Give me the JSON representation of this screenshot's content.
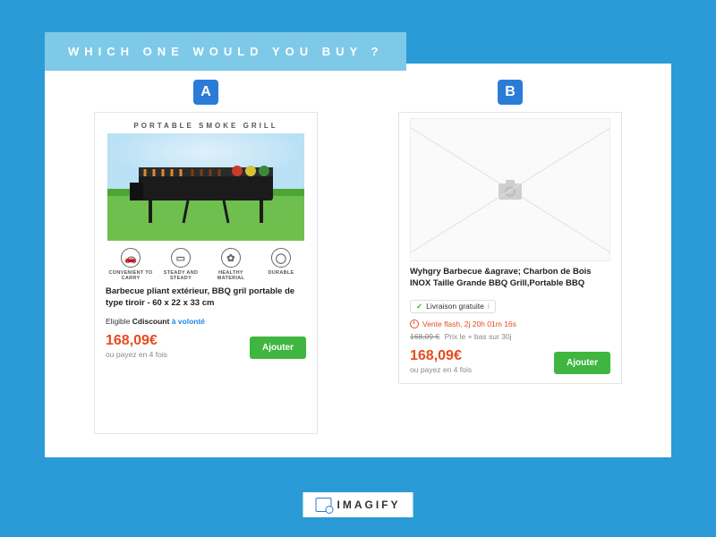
{
  "banner": "WHICH ONE WOULD YOU BUY ?",
  "badges": {
    "a": "A",
    "b": "B"
  },
  "productA": {
    "img_banner": "PORTABLE SMOKE GRILL",
    "features": [
      {
        "icon": "🚗",
        "label": "CONVENIENT TO CARRY"
      },
      {
        "icon": "▭",
        "label": "STEADY AND STEADY"
      },
      {
        "icon": "✿",
        "label": "HEALTHY MATERIAL"
      },
      {
        "icon": "◯",
        "label": "DURABLE"
      }
    ],
    "title": "Barbecue pliant extérieur, BBQ gril portable de type tiroir - 60 x 22 x 33 cm",
    "eligible_lead": "Eligible ",
    "eligible_brand": "Cdiscount",
    "eligible_link": " à volonté",
    "price": "168,09€",
    "price_sub": "ou payez en 4 fois",
    "button": "Ajouter"
  },
  "productB": {
    "title": "Wyhgry Barbecue &agrave; Charbon de Bois INOX Taille Grande BBQ Grill,Portable BBQ",
    "free_ship": "Livraison gratuite",
    "info": "i",
    "flash": "Vente flash, 2j 20h 01m 16s",
    "old_price": "168,09 €",
    "low_price": "Prix le + bas sur 30j",
    "price": "168,09€",
    "price_sub": "ou payez en 4 fois",
    "button": "Ajouter"
  },
  "brand": "IMAGIFY"
}
